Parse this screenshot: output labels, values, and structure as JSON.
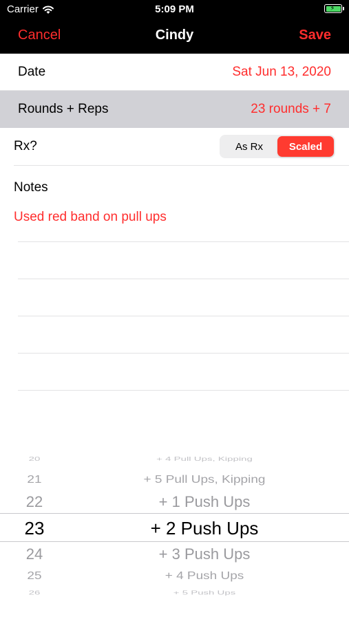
{
  "status": {
    "carrier": "Carrier",
    "time": "5:09 PM"
  },
  "nav": {
    "cancel": "Cancel",
    "title": "Cindy",
    "save": "Save"
  },
  "date": {
    "label": "Date",
    "value": "Sat Jun 13, 2020"
  },
  "rounds": {
    "label": "Rounds + Reps",
    "value": "23 rounds + 7"
  },
  "rx": {
    "label": "Rx?",
    "options": [
      "As Rx",
      "Scaled"
    ],
    "selected": "Scaled"
  },
  "notes": {
    "label": "Notes",
    "text": "Used red band on pull ups"
  },
  "picker": {
    "rows": [
      {
        "num": "20",
        "label": "+ 4 Pull Ups, Kipping"
      },
      {
        "num": "21",
        "label": "+ 5 Pull Ups, Kipping"
      },
      {
        "num": "22",
        "label": "+ 1 Push Ups"
      },
      {
        "num": "23",
        "label": "+ 2 Push Ups"
      },
      {
        "num": "24",
        "label": "+ 3 Push Ups"
      },
      {
        "num": "25",
        "label": "+ 4 Push Ups"
      },
      {
        "num": "26",
        "label": "+ 5 Push Ups"
      }
    ]
  },
  "colors": {
    "accent": "#ff2d2d",
    "segment_selected": "#ff3b30",
    "highlight_row": "#d1d1d6"
  }
}
